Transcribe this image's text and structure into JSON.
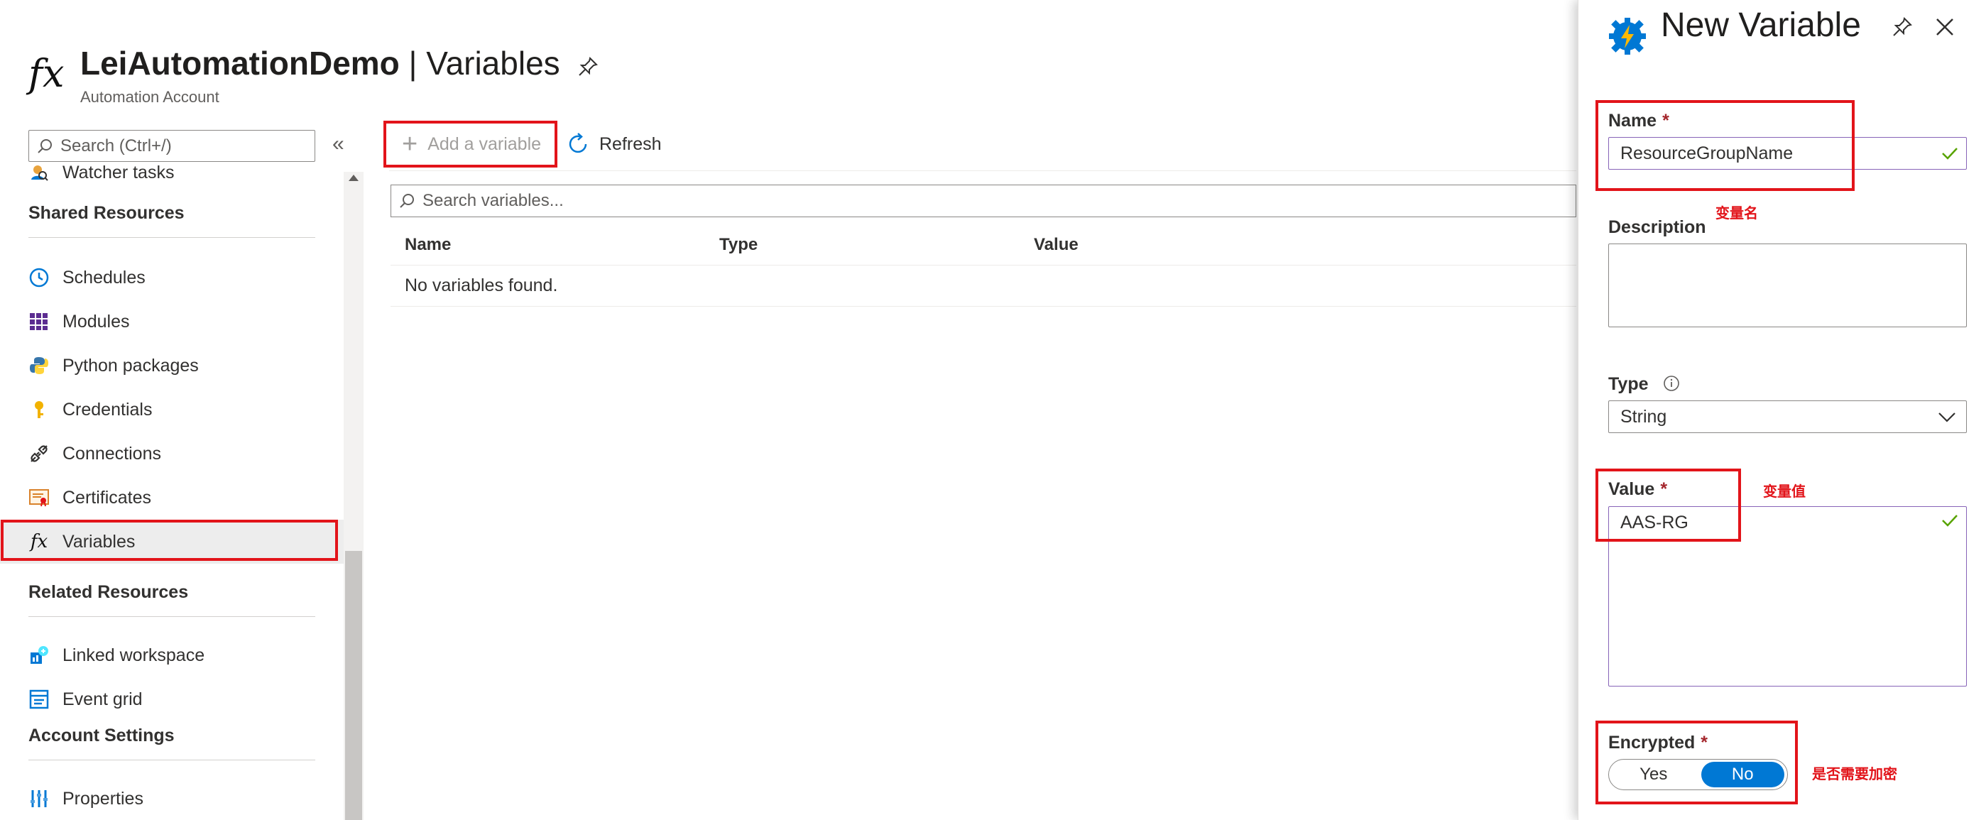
{
  "header": {
    "logo_glyph": "fx",
    "title_bold": "LeiAutomationDemo",
    "title_sep": " | ",
    "title_rest": "Variables",
    "subtitle": "Automation Account",
    "pin_icon": "pin-icon"
  },
  "sidebar": {
    "search_placeholder": "Search (Ctrl+/)",
    "collapse_glyph": "«",
    "items_top": [
      {
        "label": "Watcher tasks",
        "icon": "watcher-icon"
      }
    ],
    "groups": [
      {
        "title": "Shared Resources",
        "items": [
          {
            "label": "Schedules",
            "icon": "clock-icon"
          },
          {
            "label": "Modules",
            "icon": "modules-icon"
          },
          {
            "label": "Python packages",
            "icon": "python-icon"
          },
          {
            "label": "Credentials",
            "icon": "key-icon"
          },
          {
            "label": "Connections",
            "icon": "plug-icon"
          },
          {
            "label": "Certificates",
            "icon": "certificate-icon"
          },
          {
            "label": "Variables",
            "icon": "fx-icon",
            "active": true
          }
        ]
      },
      {
        "title": "Related Resources",
        "items": [
          {
            "label": "Linked workspace",
            "icon": "workspace-icon"
          },
          {
            "label": "Event grid",
            "icon": "eventgrid-icon"
          }
        ]
      },
      {
        "title": "Account Settings",
        "items": [
          {
            "label": "Properties",
            "icon": "properties-icon"
          }
        ]
      }
    ]
  },
  "toolbar": {
    "add_label": "Add a variable",
    "refresh_label": "Refresh"
  },
  "main": {
    "search_placeholder": "Search variables...",
    "columns": [
      "Name",
      "Type",
      "Value"
    ],
    "empty_text": "No variables found."
  },
  "panel": {
    "title": "New Variable",
    "name_label": "Name",
    "name_value": "ResourceGroupName",
    "description_label": "Description",
    "description_value": "",
    "type_label": "Type",
    "type_value": "String",
    "value_label": "Value",
    "value_value": "AAS-RG",
    "encrypted_label": "Encrypted",
    "required_mark": "*",
    "encrypted_options": [
      "Yes",
      "No"
    ],
    "encrypted_selected": "No",
    "annotations": {
      "name_note": "变量名",
      "value_note": "变量值",
      "encrypted_note": "是否需要加密"
    }
  },
  "colors": {
    "accent": "#0078d4",
    "highlight_box": "#e2141a",
    "required": "#a4262c",
    "valid_check": "#57a300"
  }
}
